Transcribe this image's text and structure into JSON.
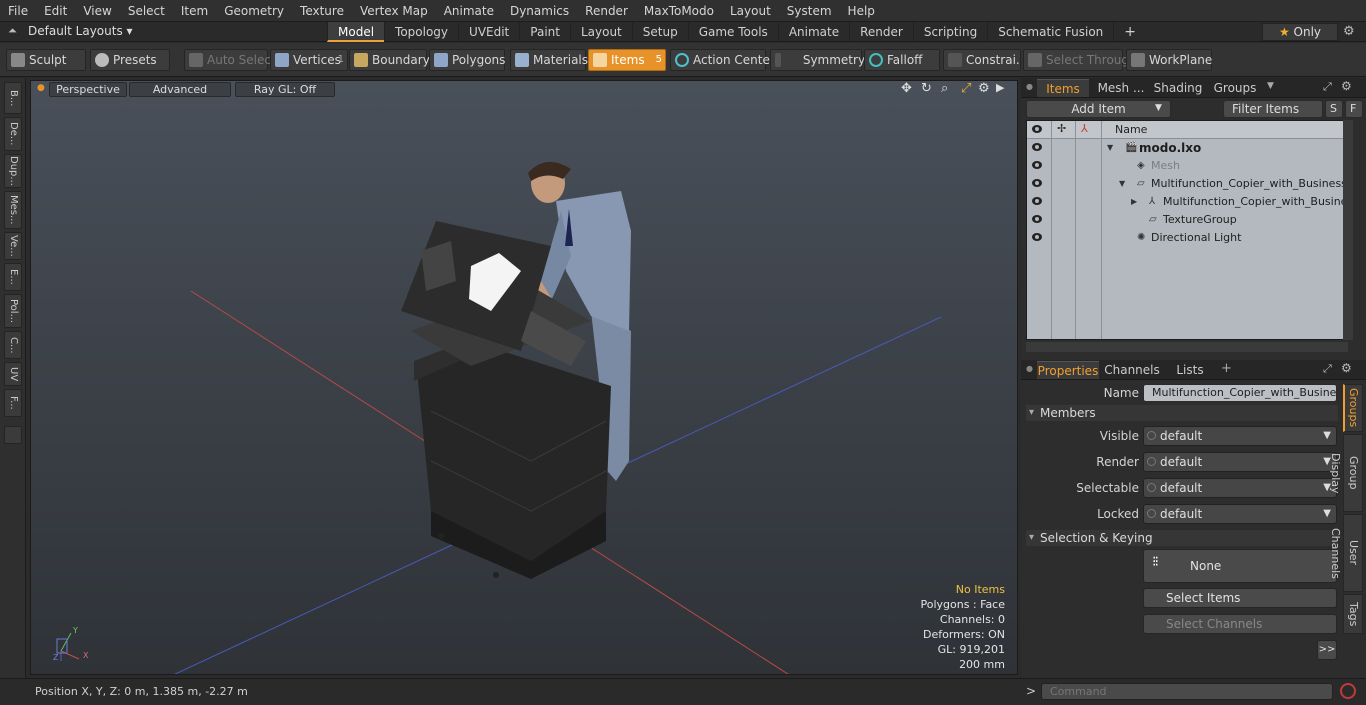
{
  "menu": [
    "File",
    "Edit",
    "View",
    "Select",
    "Item",
    "Geometry",
    "Texture",
    "Vertex Map",
    "Animate",
    "Dynamics",
    "Render",
    "MaxToModo",
    "Layout",
    "System",
    "Help"
  ],
  "layouts_label": "Default Layouts ▾",
  "tabs": [
    {
      "label": "Model",
      "active": true
    },
    {
      "label": "Topology"
    },
    {
      "label": "UVEdit"
    },
    {
      "label": "Paint"
    },
    {
      "label": "Layout"
    },
    {
      "label": "Setup"
    },
    {
      "label": "Game Tools"
    },
    {
      "label": "Animate"
    },
    {
      "label": "Render"
    },
    {
      "label": "Scripting"
    },
    {
      "label": "Schematic Fusion"
    }
  ],
  "tab_add": "+",
  "only_label": "Only",
  "toolbar": {
    "sculpt": "Sculpt",
    "presets": "Presets",
    "auto_select": "Auto Select",
    "vertices": "Vertices",
    "vertices_count": "1",
    "boundary": "Boundary",
    "polygons": "Polygons",
    "materials": "Materials",
    "items": "Items",
    "items_count": "5",
    "action_center": "Action Center",
    "symmetry": "Symmetry",
    "falloff": "Falloff",
    "constraints": "Constrai...",
    "select_through": "Select Through",
    "workplane": "WorkPlane"
  },
  "left_tabs": [
    "B...",
    "De...",
    "Dup...",
    "Mes...",
    "Ve...",
    "E...",
    "Pol...",
    "C...",
    "UV",
    "F..."
  ],
  "viewport": {
    "perspective": "Perspective",
    "advanced": "Advanced",
    "raygl": "Ray GL: Off",
    "hud": {
      "no_items": "No Items",
      "polygons": "Polygons : Face",
      "channels": "Channels: 0",
      "deformers": "Deformers: ON",
      "gl": "GL: 919,201",
      "scale": "200 mm"
    },
    "axis_y": "Y",
    "axis_x": "X",
    "axis_z": "Z"
  },
  "items_panel": {
    "tabs": [
      "Items",
      "Mesh ...",
      "Shading",
      "Groups"
    ],
    "add_item": "Add Item",
    "filter": "Filter Items",
    "s": "S",
    "f": "F",
    "name_header": "Name",
    "rows": [
      {
        "label": "modo.lxo",
        "bold": true
      },
      {
        "label": "Mesh",
        "dim": true
      },
      {
        "label": "Multifunction_Copier_with_Business_ ..."
      },
      {
        "label": "Multifunction_Copier_with_Busines ..."
      },
      {
        "label": "TextureGroup"
      },
      {
        "label": "Directional Light"
      }
    ]
  },
  "properties": {
    "tabs": [
      "Properties",
      "Channels",
      "Lists"
    ],
    "tab_add": "+",
    "name_label": "Name",
    "name_value": "Multifunction_Copier_with_Business_M",
    "members": "Members",
    "visible_label": "Visible",
    "visible": "default",
    "render_label": "Render",
    "render": "default",
    "selectable_label": "Selectable",
    "selectable": "default",
    "locked_label": "Locked",
    "locked": "default",
    "sel_keying": "Selection & Keying",
    "none": "None",
    "select_items": "Select Items",
    "select_channels": "Select Channels",
    "more": ">>",
    "vtabs": [
      "Groups",
      "Group Display",
      "User Channels",
      "Tags"
    ]
  },
  "status": {
    "position": "Position X, Y, Z:   0 m, 1.385 m, -2.27 m",
    "prompt": ">",
    "command_placeholder": "Command"
  },
  "colors": {
    "accent": "#e8932a",
    "viewport_top": "#49505a",
    "tree_bg": "#b4b9bf"
  }
}
